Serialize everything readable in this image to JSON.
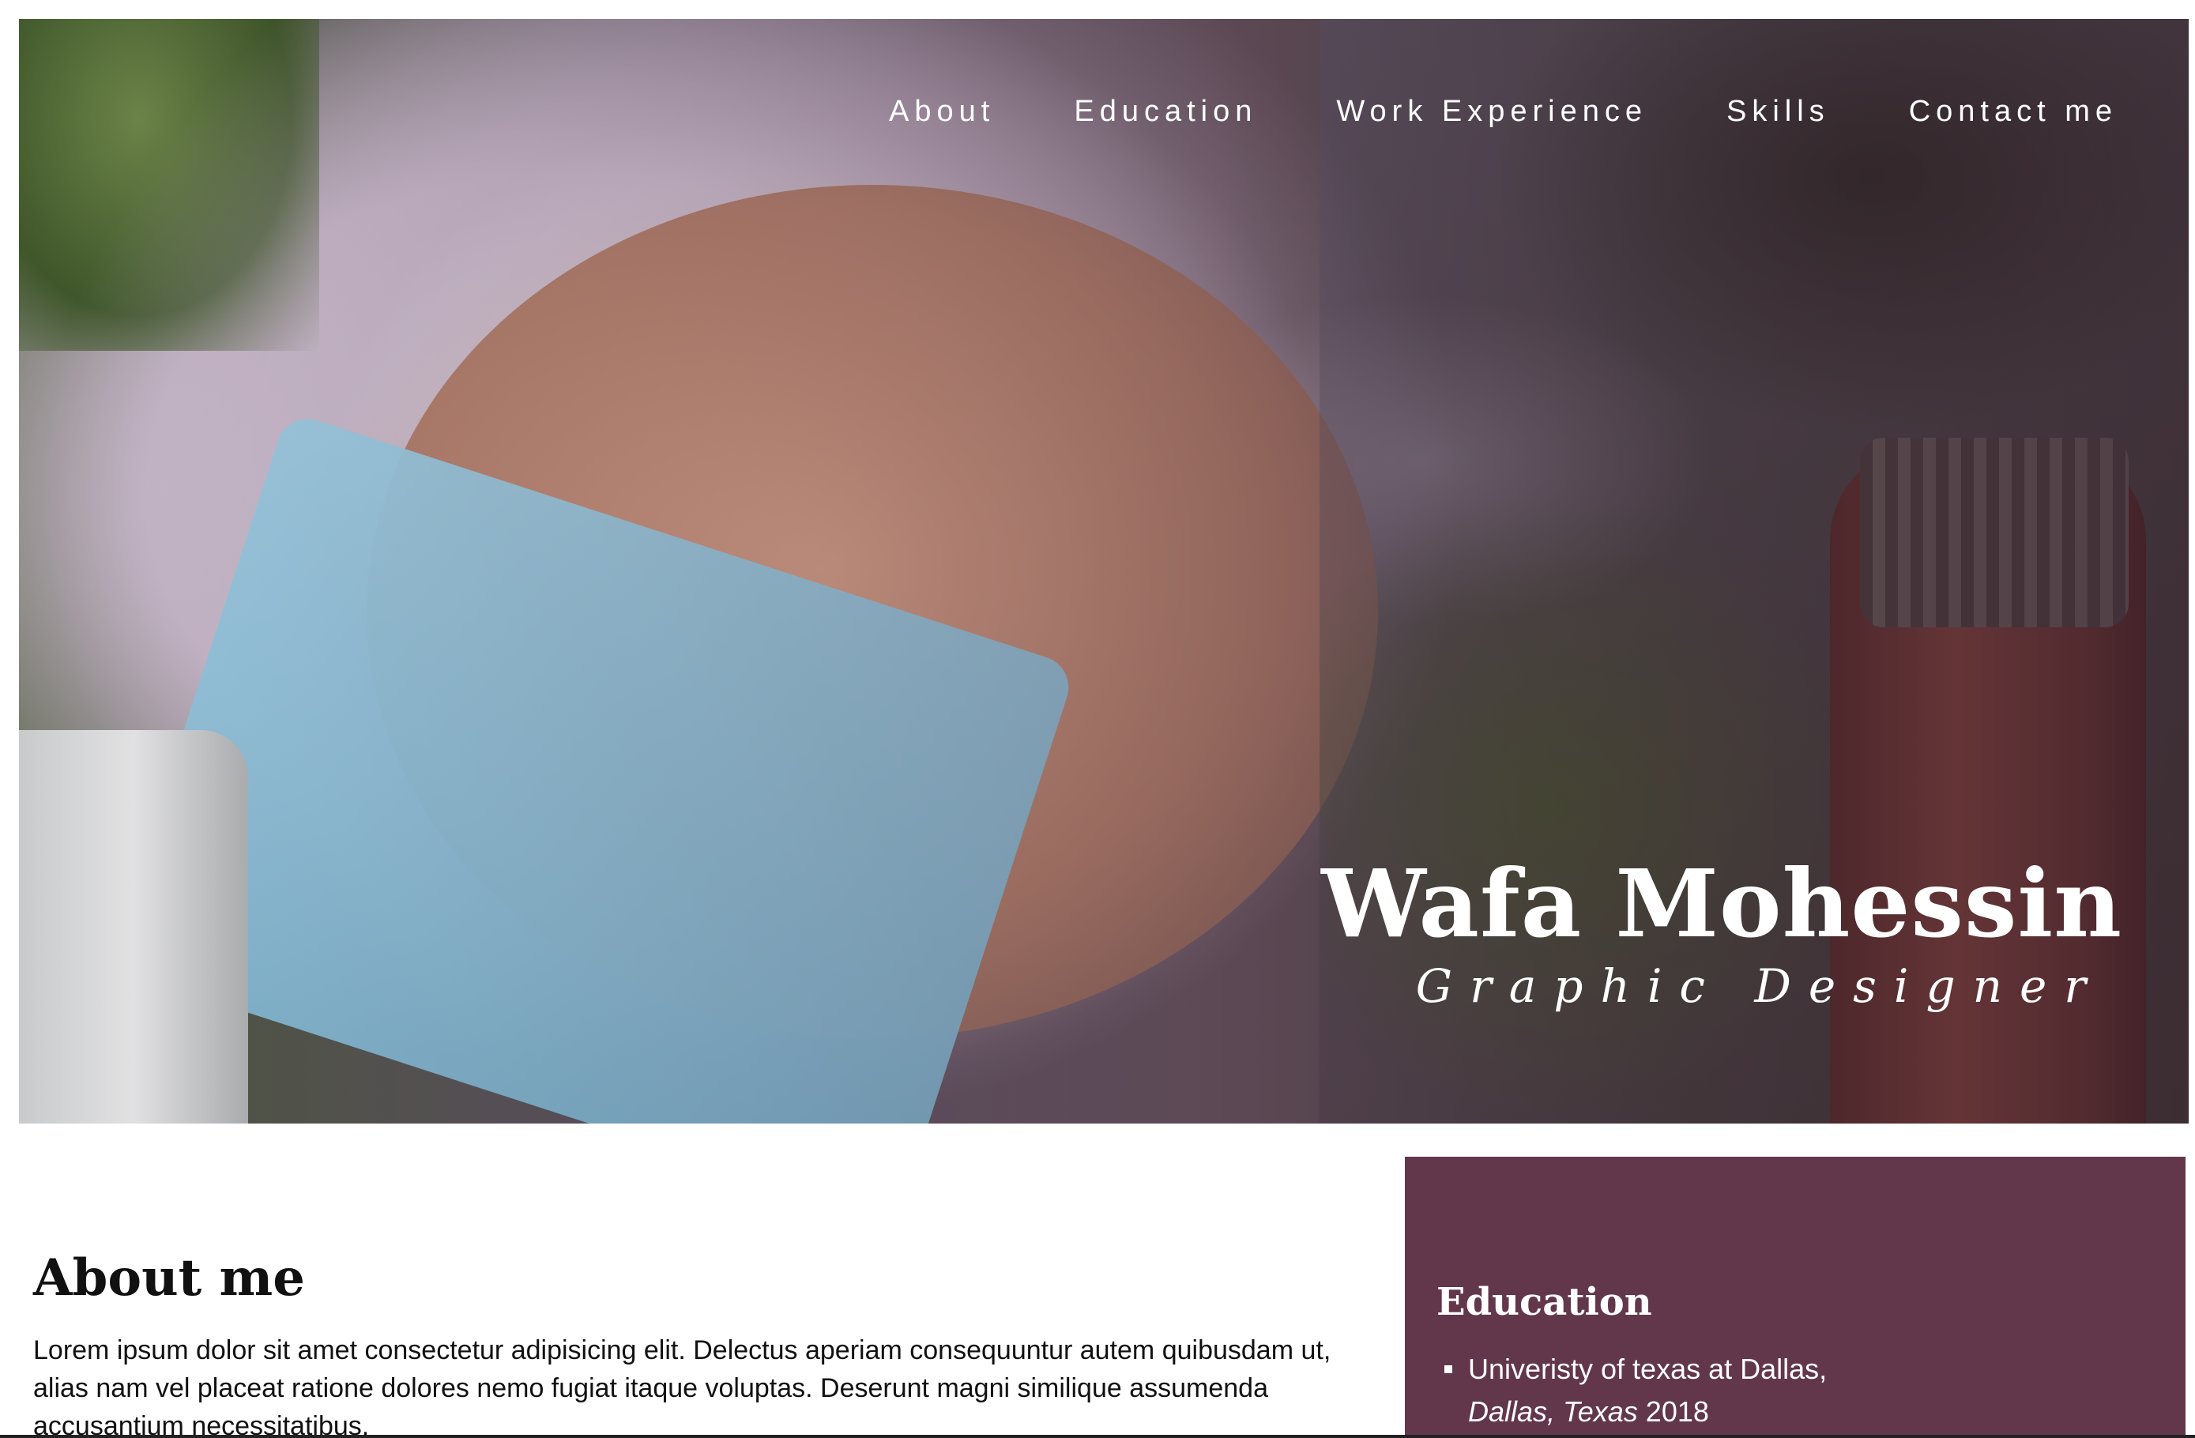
{
  "nav": {
    "items": [
      {
        "label": "About"
      },
      {
        "label": "Education"
      },
      {
        "label": "Work Experience"
      },
      {
        "label": "Skills"
      },
      {
        "label": "Contact me"
      }
    ]
  },
  "hero": {
    "name": "Wafa Mohessin",
    "title": "Graphic Designer"
  },
  "about": {
    "heading": "About me",
    "text": "Lorem ipsum dolor sit amet consectetur adipisicing elit. Delectus aperiam consequuntur autem quibusdam ut, alias nam vel placeat ratione dolores nemo fugiat itaque voluptas. Deserunt magni similique assumenda accusantium necessitatibus."
  },
  "education": {
    "heading": "Education",
    "items": [
      {
        "school": "Univeristy of texas at Dallas,",
        "location": "Dallas, Texas",
        "year": "2018"
      }
    ]
  },
  "colors": {
    "accent_panel": "#62364b",
    "text_light": "#ffffff",
    "text_dark": "#111111"
  }
}
